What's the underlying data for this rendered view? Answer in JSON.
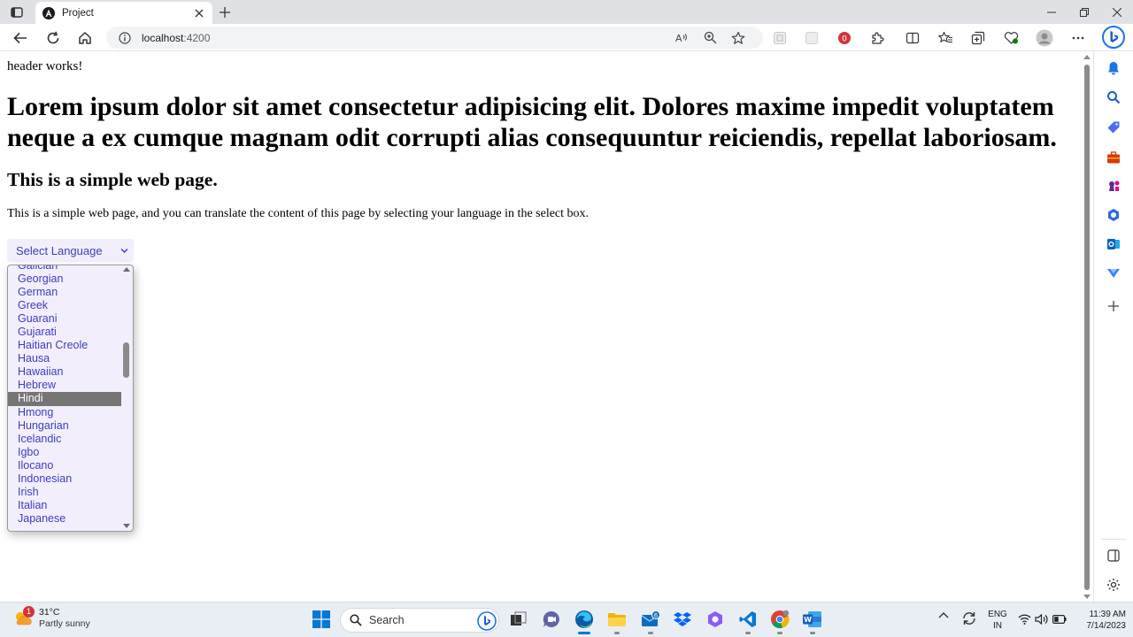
{
  "browser": {
    "tab_title": "Project",
    "address_host": "localhost",
    "address_path": ":4200",
    "read_aloud_label": "A͈",
    "extension_badge": "0"
  },
  "page": {
    "header_text": "header works!",
    "heading": "Lorem ipsum dolor sit amet consectetur adipisicing elit. Dolores maxime impedit voluptatem neque a ex cumque magnam odit corrupti alias consequuntur reiciendis, repellat laboriosam.",
    "subheading": "This is a simple web page.",
    "paragraph": "This is a simple web page, and you can translate the content of this page by selecting your language in the select box.",
    "select": {
      "label": "Select Language",
      "selected": "Hindi",
      "options": [
        "Galician",
        "Georgian",
        "German",
        "Greek",
        "Guarani",
        "Gujarati",
        "Haitian Creole",
        "Hausa",
        "Hawaiian",
        "Hebrew",
        "Hindi",
        "Hmong",
        "Hungarian",
        "Icelandic",
        "Igbo",
        "Ilocano",
        "Indonesian",
        "Irish",
        "Italian",
        "Japanese"
      ]
    }
  },
  "taskbar": {
    "weather_temp": "31°C",
    "weather_desc": "Partly sunny",
    "weather_badge": "1",
    "search_label": "Search",
    "mail_badge": "6",
    "lang_top": "ENG",
    "lang_bottom": "IN",
    "time": "11:39 AM",
    "date": "7/14/2023"
  },
  "colors": {
    "accent": "#3a3fbf",
    "select_bg": "#f3eefc",
    "selected_option_bg": "#757575"
  }
}
